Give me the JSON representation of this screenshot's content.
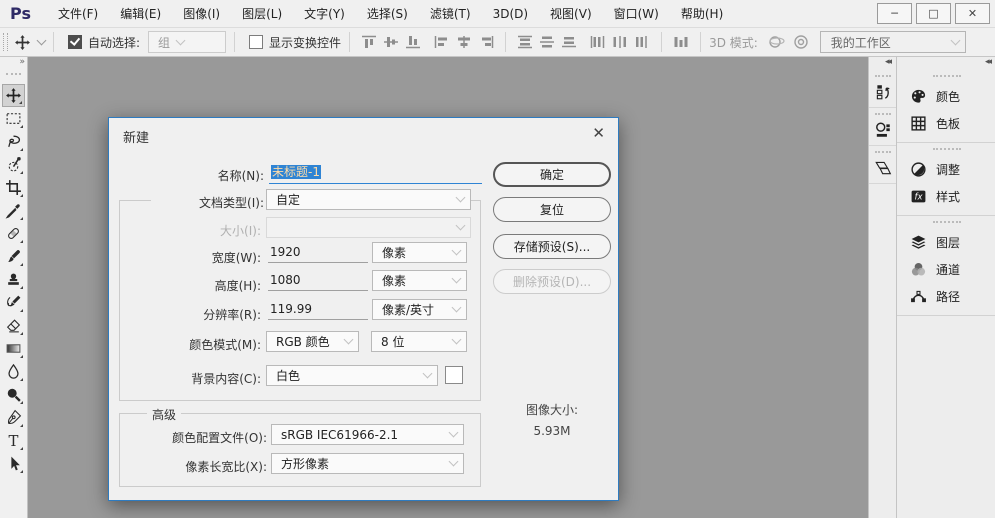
{
  "app": {
    "logo": "Ps",
    "menu": [
      "文件(F)",
      "编辑(E)",
      "图像(I)",
      "图层(L)",
      "文字(Y)",
      "选择(S)",
      "滤镜(T)",
      "3D(D)",
      "视图(V)",
      "窗口(W)",
      "帮助(H)"
    ],
    "window_controls": {
      "minimize": "─",
      "maximize": "□",
      "close": "✕"
    }
  },
  "options_bar": {
    "auto_select_label": "自动选择:",
    "auto_select_checked": true,
    "group_value": "组",
    "show_transform_label": "显示变换控件",
    "show_transform_checked": false,
    "mode_label": "3D 模式:",
    "workspace_value": "我的工作区"
  },
  "toolbox": {
    "expand_glyph": "»",
    "selected_tool": "move",
    "tools": [
      "move",
      "rectangular-marquee",
      "lasso",
      "quick-selection",
      "crop",
      "eyedropper",
      "spot-healing-brush",
      "brush",
      "clone-stamp",
      "history-brush",
      "eraser",
      "gradient",
      "blur",
      "dodge",
      "pen",
      "type",
      "path-selection"
    ]
  },
  "dialog": {
    "title": "新建",
    "close_glyph": "✕",
    "fields": {
      "name_label": "名称(N):",
      "name_value": "未标题-1",
      "doc_type_label": "文档类型(I):",
      "doc_type_value": "自定",
      "size_label": "大小(I):",
      "size_value": "",
      "width_label": "宽度(W):",
      "width_value": "1920",
      "width_unit": "像素",
      "height_label": "高度(H):",
      "height_value": "1080",
      "height_unit": "像素",
      "resolution_label": "分辨率(R):",
      "resolution_value": "119.99",
      "resolution_unit": "像素/英寸",
      "color_mode_label": "颜色模式(M):",
      "color_mode_value": "RGB 颜色",
      "bit_depth_value": "8 位",
      "background_label": "背景内容(C):",
      "background_value": "白色",
      "advanced_label": "高级",
      "profile_label": "颜色配置文件(O):",
      "profile_value": "sRGB IEC61966-2.1",
      "aspect_label": "像素长宽比(X):",
      "aspect_value": "方形像素"
    },
    "buttons": {
      "ok": "确定",
      "reset": "复位",
      "save_preset": "存储预设(S)...",
      "delete_preset": "删除预设(D)..."
    },
    "image_size_label": "图像大小:",
    "image_size_value": "5.93M"
  },
  "panels": {
    "collapse_glyph": "◂◂",
    "narrow_icons": [
      "history-panel",
      "properties-panel",
      "info-panel"
    ],
    "tabs": [
      {
        "label": "颜色",
        "icon": "color-palette"
      },
      {
        "label": "色板",
        "icon": "swatches-grid"
      },
      {
        "label": "调整",
        "icon": "adjustments-circle"
      },
      {
        "label": "样式",
        "icon": "styles-fx"
      },
      {
        "label": "图层",
        "icon": "layers-stack"
      },
      {
        "label": "通道",
        "icon": "channels-circles"
      },
      {
        "label": "路径",
        "icon": "paths-bezier"
      }
    ],
    "styles_fx_glyph": "fx"
  },
  "colors": {
    "chrome_bg": "#f0f0f0",
    "canvas_bg": "#999999",
    "dialog_border": "#2e7bc0",
    "selection_bg": "#2f84d4",
    "selection_text": "#ffdca8",
    "ps_logo": "#2e2a66"
  }
}
